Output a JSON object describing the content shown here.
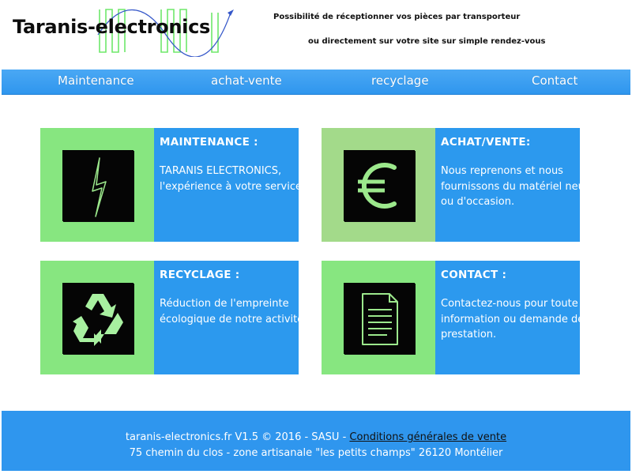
{
  "header": {
    "logo_text": "Taranis-electronics",
    "tagline_1": "Possibilité de réceptionner vos pièces par transporteur",
    "tagline_2": "ou directement sur votre site sur simple rendez-vous"
  },
  "nav": {
    "items": [
      {
        "label": "Maintenance"
      },
      {
        "label": "achat-vente"
      },
      {
        "label": "recyclage"
      },
      {
        "label": "Contact"
      }
    ]
  },
  "cards": [
    {
      "title": "MAINTENANCE :",
      "description": "TARANIS ELECTRONICS, l'expérience à votre service.",
      "icon": "lightning-icon",
      "thumb_color": "#87e680"
    },
    {
      "title": "ACHAT/VENTE:",
      "description": "Nous reprenons et nous fournissons du matériel neuf ou d'occasion.",
      "icon": "euro-icon",
      "thumb_color": "#a3da8a"
    },
    {
      "title": "RECYCLAGE :",
      "description": "Réduction de l'empreinte écologique de notre activité.",
      "icon": "recycle-icon",
      "thumb_color": "#87e680"
    },
    {
      "title": "CONTACT :",
      "description": "Contactez-nous pour toute information ou demande de prestation.",
      "icon": "document-icon",
      "thumb_color": "#87e680"
    }
  ],
  "footer": {
    "line1_prefix": "taranis-electronics.fr V1.5 © 2016 - SASU -",
    "cgv_link": "Conditions générales de vente",
    "line2": "75 chemin du clos - zone artisanale \"les petits champs\" 26120 Montélier"
  },
  "colors": {
    "accent_blue": "#2c99ee",
    "green": "#87e680",
    "icon_green": "#9ce88c"
  }
}
